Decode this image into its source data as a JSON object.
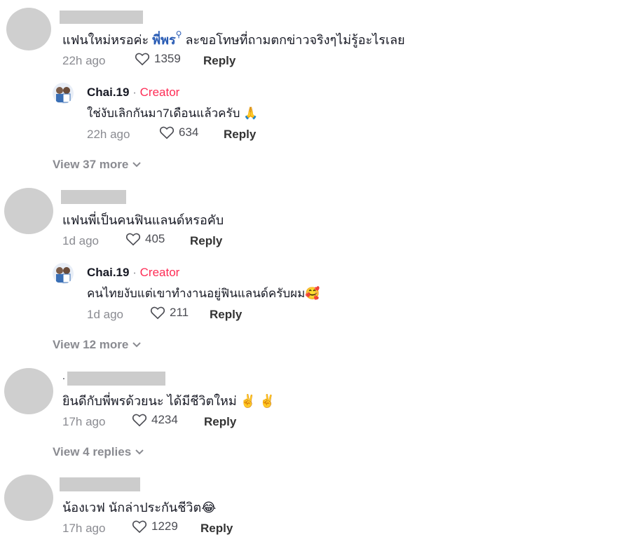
{
  "comments": [
    {
      "text_before": "แฟนใหม่หรอค่ะ ",
      "mention": "พี่พร",
      "text_after": " ละขอโทษที่ถามตกข่าวจริงๆไม่รู้อะไรเลย",
      "time": "22h ago",
      "likes": "1359",
      "reply": "Reply",
      "creator_reply": {
        "name": "Chai.19",
        "separator": "·",
        "badge": "Creator",
        "text": "ใช่งับเลิกกันมา7เดือนแล้วครับ ",
        "emoji": "🙏",
        "time": "22h ago",
        "likes": "634",
        "reply": "Reply"
      },
      "view_more": "View 37 more"
    },
    {
      "text": "แฟนพี่เป็นคนฟินแลนด์หรอคับ",
      "time": "1d ago",
      "likes": "405",
      "reply": "Reply",
      "creator_reply": {
        "name": "Chai.19",
        "separator": "·",
        "badge": "Creator",
        "text": "คนไทยงับแต่เขาทำงานอยู่ฟินแลนด์ครับผม",
        "emoji": "🥰",
        "time": "1d ago",
        "likes": "211",
        "reply": "Reply"
      },
      "view_more": "View 12 more"
    },
    {
      "dot": ".",
      "text": "ยินดีกับพี่พรด้วยนะ ได้มีชีวิตใหม่ ",
      "emoji": "✌️ ✌️",
      "time": "17h ago",
      "likes": "4234",
      "reply": "Reply",
      "view_more": "View 4 replies"
    },
    {
      "text": "น้องเวฟ นักล่าประกันชีวิต",
      "emoji": "😂",
      "time": "17h ago",
      "likes": "1229",
      "reply": "Reply"
    }
  ],
  "icons": {
    "heart": "heart-outline-icon",
    "chevron": "chevron-down-icon",
    "search": "search-icon"
  },
  "colors": {
    "creator": "#fe2c55",
    "mention": "#2b5db5",
    "muted": "#8a8b91"
  }
}
